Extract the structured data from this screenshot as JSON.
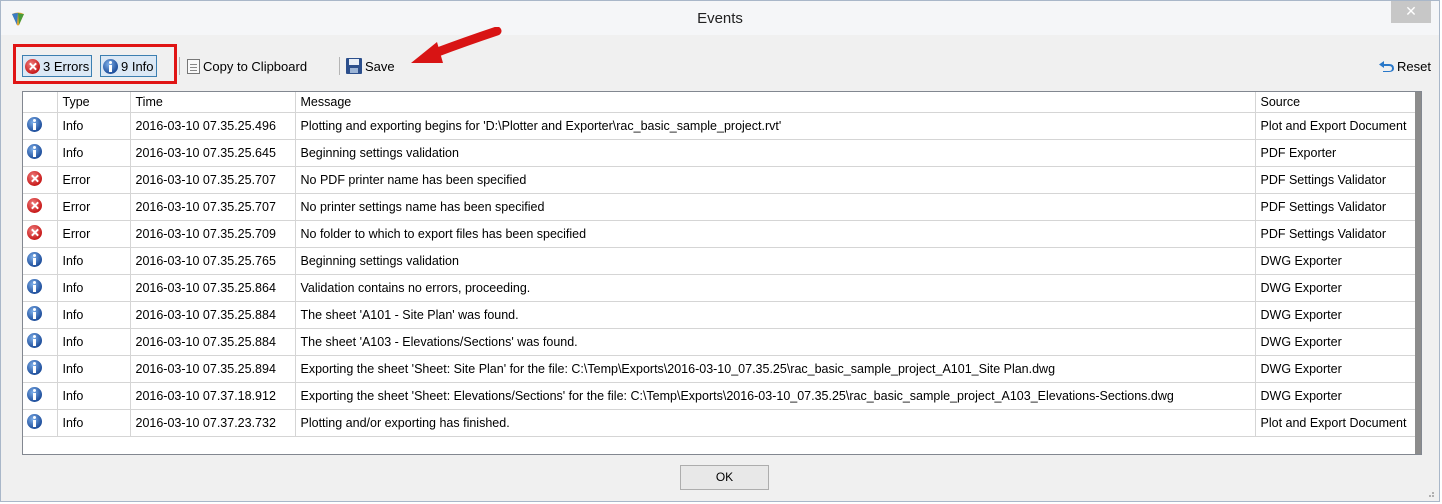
{
  "window": {
    "title": "Events",
    "close_glyph": "✕"
  },
  "toolbar": {
    "errors_label": "3 Errors",
    "info_label": "9 Info",
    "copy_label": "Copy to Clipboard",
    "save_label": "Save",
    "reset_label": "Reset"
  },
  "table": {
    "headers": {
      "type": "Type",
      "time": "Time",
      "message": "Message",
      "source": "Source"
    },
    "rows": [
      {
        "icon": "info-icon",
        "type": "Info",
        "time": "2016-03-10 07.35.25.496",
        "message": "Plotting and exporting begins for 'D:\\Plotter and Exporter\\rac_basic_sample_project.rvt'",
        "source": "Plot and Export Document"
      },
      {
        "icon": "info-icon",
        "type": "Info",
        "time": "2016-03-10 07.35.25.645",
        "message": "Beginning settings validation",
        "source": "PDF Exporter"
      },
      {
        "icon": "error-icon",
        "type": "Error",
        "time": "2016-03-10 07.35.25.707",
        "message": "No PDF printer name has been specified",
        "source": "PDF Settings Validator"
      },
      {
        "icon": "error-icon",
        "type": "Error",
        "time": "2016-03-10 07.35.25.707",
        "message": "No printer settings name has been specified",
        "source": "PDF Settings Validator"
      },
      {
        "icon": "error-icon",
        "type": "Error",
        "time": "2016-03-10 07.35.25.709",
        "message": "No folder to which to export files has been specified",
        "source": "PDF Settings Validator"
      },
      {
        "icon": "info-icon",
        "type": "Info",
        "time": "2016-03-10 07.35.25.765",
        "message": "Beginning settings validation",
        "source": "DWG Exporter"
      },
      {
        "icon": "info-icon",
        "type": "Info",
        "time": "2016-03-10 07.35.25.864",
        "message": "Validation contains no errors, proceeding.",
        "source": "DWG Exporter"
      },
      {
        "icon": "info-icon",
        "type": "Info",
        "time": "2016-03-10 07.35.25.884",
        "message": "The sheet 'A101 - Site Plan' was found.",
        "source": "DWG Exporter"
      },
      {
        "icon": "info-icon",
        "type": "Info",
        "time": "2016-03-10 07.35.25.884",
        "message": "The sheet 'A103 - Elevations/Sections' was found.",
        "source": "DWG Exporter"
      },
      {
        "icon": "info-icon",
        "type": "Info",
        "time": "2016-03-10 07.35.25.894",
        "message": "Exporting the sheet 'Sheet: Site Plan' for the file:  C:\\Temp\\Exports\\2016-03-10_07.35.25\\rac_basic_sample_project_A101_Site Plan.dwg",
        "source": "DWG Exporter"
      },
      {
        "icon": "info-icon",
        "type": "Info",
        "time": "2016-03-10 07.37.18.912",
        "message": "Exporting the sheet 'Sheet: Elevations/Sections' for the file:  C:\\Temp\\Exports\\2016-03-10_07.35.25\\rac_basic_sample_project_A103_Elevations-Sections.dwg",
        "source": "DWG Exporter"
      },
      {
        "icon": "info-icon",
        "type": "Info",
        "time": "2016-03-10 07.37.23.732",
        "message": "Plotting and/or exporting has finished.",
        "source": "Plot and Export Document"
      }
    ]
  },
  "footer": {
    "ok_label": "OK"
  },
  "colors": {
    "highlight_box": "#e01515",
    "arrow": "#d81414",
    "error": "#c81a1a",
    "info": "#1f4f9c"
  }
}
